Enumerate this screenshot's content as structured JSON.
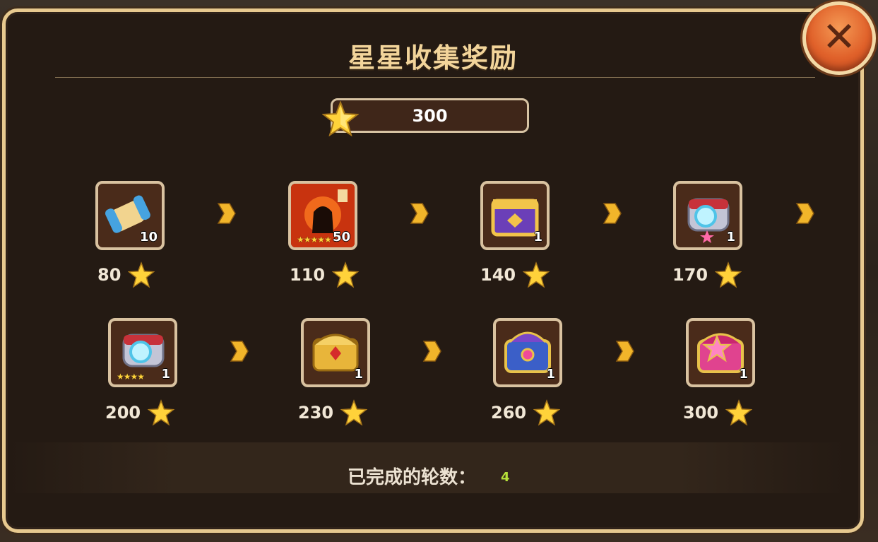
{
  "title": "星星收集奖励",
  "star_total": "300",
  "rewards": [
    {
      "name": "scroll",
      "qty": "10",
      "cost": "80"
    },
    {
      "name": "monster-rune",
      "qty": "50",
      "cost": "110"
    },
    {
      "name": "purple-chest",
      "qty": "1",
      "cost": "140"
    },
    {
      "name": "pink-star-summon-ring",
      "qty": "1",
      "cost": "170"
    },
    {
      "name": "four-star-summon-ring",
      "qty": "1",
      "cost": "200"
    },
    {
      "name": "gold-chest",
      "qty": "1",
      "cost": "230"
    },
    {
      "name": "blue-purple-chest",
      "qty": "1",
      "cost": "260"
    },
    {
      "name": "pink-star-chest",
      "qty": "1",
      "cost": "300"
    }
  ],
  "rounds": {
    "label": "已完成的轮数：",
    "value": "4"
  },
  "close_icon": "close-x-icon",
  "colors": {
    "frame": "#e7c98f",
    "accent_text": "#f2d49a",
    "close": "#e0612a",
    "rounds_value": "#b6e13a"
  }
}
